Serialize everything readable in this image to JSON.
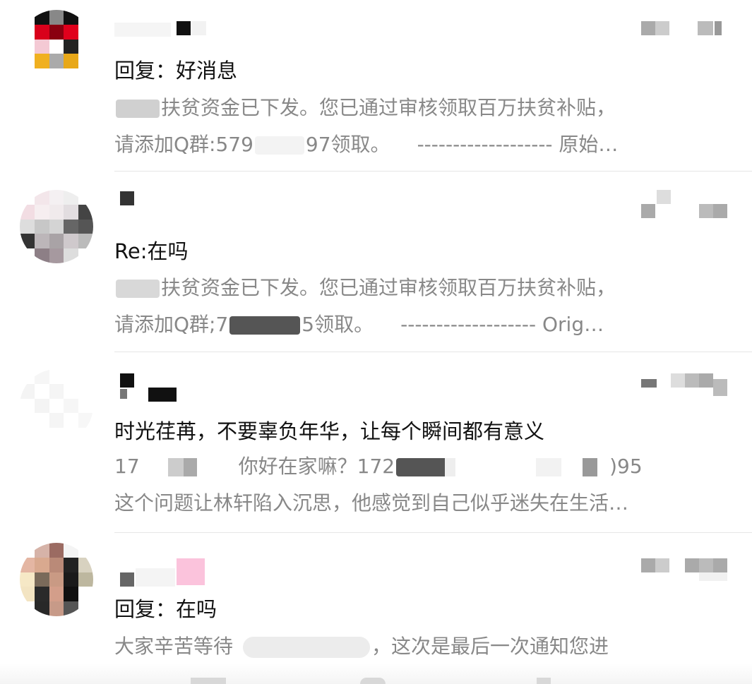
{
  "mail_list": {
    "items": [
      {
        "subject": "回复：好消息",
        "preview_line1_prefix": "",
        "preview_line1": "扶贫资金已下发。您已通过审核领取百万扶贫补贴，",
        "preview_line2_a": "请添加Q群:579",
        "preview_line2_b": "97领取。",
        "preview_line2_c": "------------------- 原始…"
      },
      {
        "subject": "Re:在吗",
        "preview_line1": "扶贫资金已下发。您已通过审核领取百万扶贫补贴，",
        "preview_line2_a": "请添加Q群;7",
        "preview_line2_b": "5领取。",
        "preview_line2_c": "------------------- Orig…"
      },
      {
        "subject": "时光荏苒，不要辜负年华，让每个瞬间都有意义",
        "preview_line1_a": "17",
        "preview_line1_b": "你好在家嘛？172",
        "preview_line1_c": ")95",
        "preview_line2": "这个问题让林轩陷入沉思，他感觉到自己似乎迷失在生活…"
      },
      {
        "subject": "回复：在吗",
        "preview_line1_a": "大家辛苦等待",
        "preview_line1_b": "，这次是最后一次通知您进"
      }
    ]
  },
  "colors": {
    "subject_text": "#111111",
    "preview_text": "#888888",
    "divider": "#e6e6e6",
    "redaction": "#cfcfcf"
  }
}
